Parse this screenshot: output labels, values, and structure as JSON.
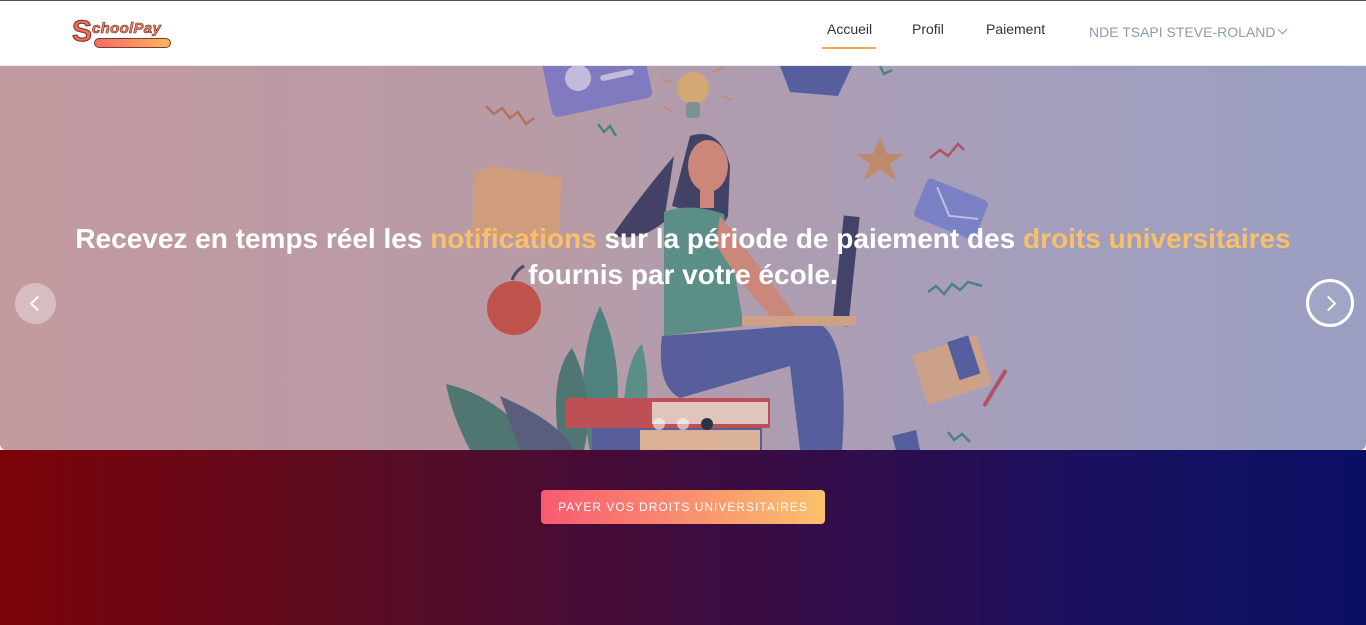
{
  "header": {
    "logo_text": "SchoolPay",
    "nav": {
      "accueil": "Accueil",
      "profil": "Profil",
      "paiement": "Paiement"
    },
    "user_name": "NDE TSAPI STEVE-ROLAND",
    "active_item": "Accueil"
  },
  "hero": {
    "caption_part1": "Recevez en temps réel les ",
    "caption_highlight1": "notifications",
    "caption_part2": " sur la période de paiement des ",
    "caption_highlight2": "droits universitaires",
    "caption_line2": "fournis par votre école.",
    "slide_count": 3,
    "active_slide": 3
  },
  "cta": {
    "label": "PAYER VOS DROITS UNIVERSITAIRES"
  },
  "colors": {
    "accent": "#fbbf6a",
    "cta_start": "#f75a72",
    "cta_end": "#fbc16b",
    "bg_left": "#7c0308",
    "bg_right": "#0a0f62"
  }
}
